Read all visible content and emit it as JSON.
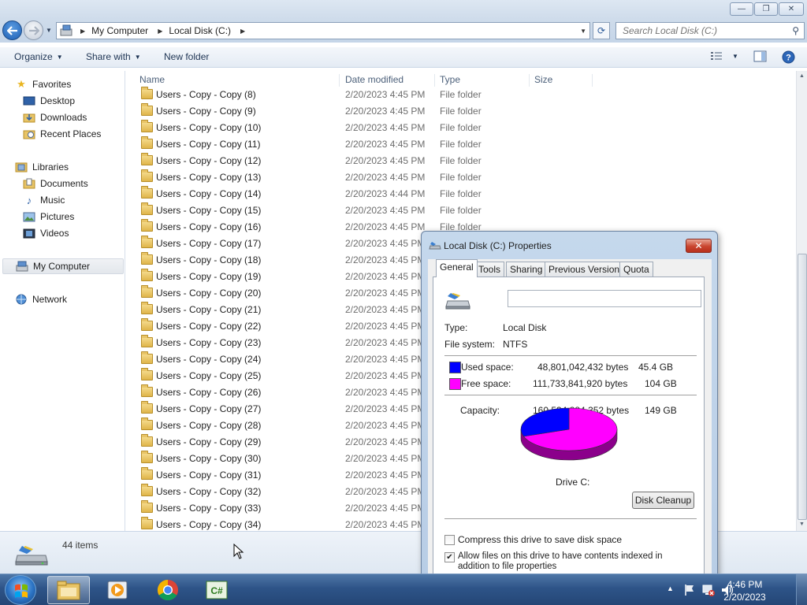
{
  "window": {
    "caption_buttons": {
      "minimize": "—",
      "maximize": "❐",
      "close": "✕"
    }
  },
  "address": {
    "crumbs": [
      "My Computer",
      "Local Disk (C:)"
    ],
    "search_placeholder": "Search Local Disk (C:)"
  },
  "toolbar": {
    "organize": "Organize",
    "share_with": "Share with",
    "new_folder": "New folder"
  },
  "nav": {
    "favorites": "Favorites",
    "desktop": "Desktop",
    "downloads": "Downloads",
    "recent_places": "Recent Places",
    "libraries": "Libraries",
    "documents": "Documents",
    "music": "Music",
    "pictures": "Pictures",
    "videos": "Videos",
    "my_computer": "My Computer",
    "network": "Network"
  },
  "columns": {
    "name": "Name",
    "date": "Date modified",
    "type": "Type",
    "size": "Size"
  },
  "files": [
    {
      "name": "Users - Copy - Copy (8)",
      "date": "2/20/2023 4:45 PM",
      "type": "File folder"
    },
    {
      "name": "Users - Copy - Copy (9)",
      "date": "2/20/2023 4:45 PM",
      "type": "File folder"
    },
    {
      "name": "Users - Copy - Copy (10)",
      "date": "2/20/2023 4:45 PM",
      "type": "File folder"
    },
    {
      "name": "Users - Copy - Copy (11)",
      "date": "2/20/2023 4:45 PM",
      "type": "File folder"
    },
    {
      "name": "Users - Copy - Copy (12)",
      "date": "2/20/2023 4:45 PM",
      "type": "File folder"
    },
    {
      "name": "Users - Copy - Copy (13)",
      "date": "2/20/2023 4:45 PM",
      "type": "File folder"
    },
    {
      "name": "Users - Copy - Copy (14)",
      "date": "2/20/2023 4:44 PM",
      "type": "File folder"
    },
    {
      "name": "Users - Copy - Copy (15)",
      "date": "2/20/2023 4:45 PM",
      "type": "File folder"
    },
    {
      "name": "Users - Copy - Copy (16)",
      "date": "2/20/2023 4:45 PM",
      "type": "File folder"
    },
    {
      "name": "Users - Copy - Copy (17)",
      "date": "2/20/2023 4:45 PM",
      "type": ""
    },
    {
      "name": "Users - Copy - Copy (18)",
      "date": "2/20/2023 4:45 PM",
      "type": ""
    },
    {
      "name": "Users - Copy - Copy (19)",
      "date": "2/20/2023 4:45 PM",
      "type": ""
    },
    {
      "name": "Users - Copy - Copy (20)",
      "date": "2/20/2023 4:45 PM",
      "type": ""
    },
    {
      "name": "Users - Copy - Copy (21)",
      "date": "2/20/2023 4:45 PM",
      "type": ""
    },
    {
      "name": "Users - Copy - Copy (22)",
      "date": "2/20/2023 4:45 PM",
      "type": ""
    },
    {
      "name": "Users - Copy - Copy (23)",
      "date": "2/20/2023 4:45 PM",
      "type": ""
    },
    {
      "name": "Users - Copy - Copy (24)",
      "date": "2/20/2023 4:45 PM",
      "type": ""
    },
    {
      "name": "Users - Copy - Copy (25)",
      "date": "2/20/2023 4:45 PM",
      "type": ""
    },
    {
      "name": "Users - Copy - Copy (26)",
      "date": "2/20/2023 4:45 PM",
      "type": ""
    },
    {
      "name": "Users - Copy - Copy (27)",
      "date": "2/20/2023 4:45 PM",
      "type": ""
    },
    {
      "name": "Users - Copy - Copy (28)",
      "date": "2/20/2023 4:45 PM",
      "type": ""
    },
    {
      "name": "Users - Copy - Copy (29)",
      "date": "2/20/2023 4:45 PM",
      "type": ""
    },
    {
      "name": "Users - Copy - Copy (30)",
      "date": "2/20/2023 4:45 PM",
      "type": ""
    },
    {
      "name": "Users - Copy - Copy (31)",
      "date": "2/20/2023 4:45 PM",
      "type": ""
    },
    {
      "name": "Users - Copy - Copy (32)",
      "date": "2/20/2023 4:45 PM",
      "type": ""
    },
    {
      "name": "Users - Copy - Copy (33)",
      "date": "2/20/2023 4:45 PM",
      "type": ""
    },
    {
      "name": "Users - Copy - Copy (34)",
      "date": "2/20/2023 4:45 PM",
      "type": ""
    }
  ],
  "details": {
    "item_count": "44 items"
  },
  "dialog": {
    "title": "Local Disk (C:) Properties",
    "close": "✕",
    "tabs": [
      "General",
      "Tools",
      "Sharing",
      "Previous Versions",
      "Quota"
    ],
    "label_value": "",
    "type_label": "Type:",
    "type_value": "Local Disk",
    "fs_label": "File system:",
    "fs_value": "NTFS",
    "used_label": "Used space:",
    "used_bytes": "48,801,042,432 bytes",
    "used_gb": "45.4 GB",
    "free_label": "Free space:",
    "free_bytes": "111,733,841,920 bytes",
    "free_gb": "104 GB",
    "capacity_label": "Capacity:",
    "capacity_bytes": "160,534,884,352 bytes",
    "capacity_gb": "149 GB",
    "drive_label": "Drive C:",
    "disk_cleanup": "Disk Cleanup",
    "compress_label": "Compress this drive to save disk space",
    "index_label": "Allow files on this drive to have contents indexed in addition to file properties",
    "compress_checked": false,
    "index_checked": true,
    "used_fraction": 0.304,
    "colors": {
      "used": "#0000ff",
      "free": "#ff00ff"
    }
  },
  "taskbar": {
    "time": "4:46 PM",
    "date": "2/20/2023",
    "apps": [
      "windows-explorer-icon",
      "media-player-icon",
      "chrome-icon",
      "csharp-ide-icon"
    ]
  }
}
